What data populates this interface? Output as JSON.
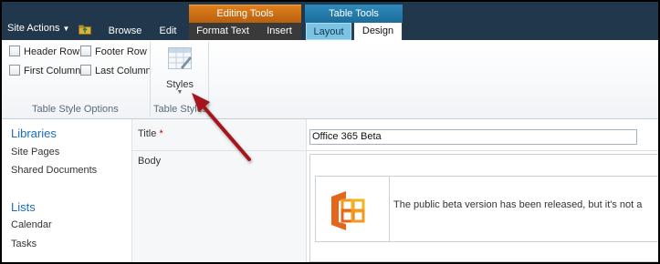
{
  "ribbon_tabs": {
    "site_actions": "Site Actions",
    "browse": "Browse",
    "edit": "Edit",
    "format_text": "Format Text",
    "insert": "Insert",
    "layout": "Layout",
    "design": "Design"
  },
  "contextual_groups": {
    "editing_tools": "Editing Tools",
    "table_tools": "Table Tools"
  },
  "table_style_options": {
    "header_row": "Header Row",
    "footer_row": "Footer Row",
    "first_column": "First Column",
    "last_column": "Last Column",
    "group_label": "Table Style Options"
  },
  "table_styles": {
    "styles_label": "Styles",
    "group_label": "Table Styles"
  },
  "leftnav": {
    "libraries_heading": "Libraries",
    "site_pages": "Site Pages",
    "shared_documents": "Shared Documents",
    "lists_heading": "Lists",
    "calendar": "Calendar",
    "tasks": "Tasks"
  },
  "form": {
    "title_label": "Title",
    "required_marker": "*",
    "title_value": "Office 365 Beta",
    "body_label": "Body",
    "body_text": "The public beta version has been released, but it's not a"
  },
  "colors": {
    "tab_bar": "#21374c",
    "editing_tools_accent": "#e07f1b",
    "table_tools_accent": "#2f8bbd",
    "link_blue": "#1b6cbf",
    "arrow_red": "#a4121b"
  },
  "icons": {
    "site_actions_caret": "chevron-down-icon",
    "navigate_up": "folder-up-icon",
    "styles": "table-styles-icon",
    "office_logo": "office-logo-icon",
    "callout": "arrow-icon"
  }
}
